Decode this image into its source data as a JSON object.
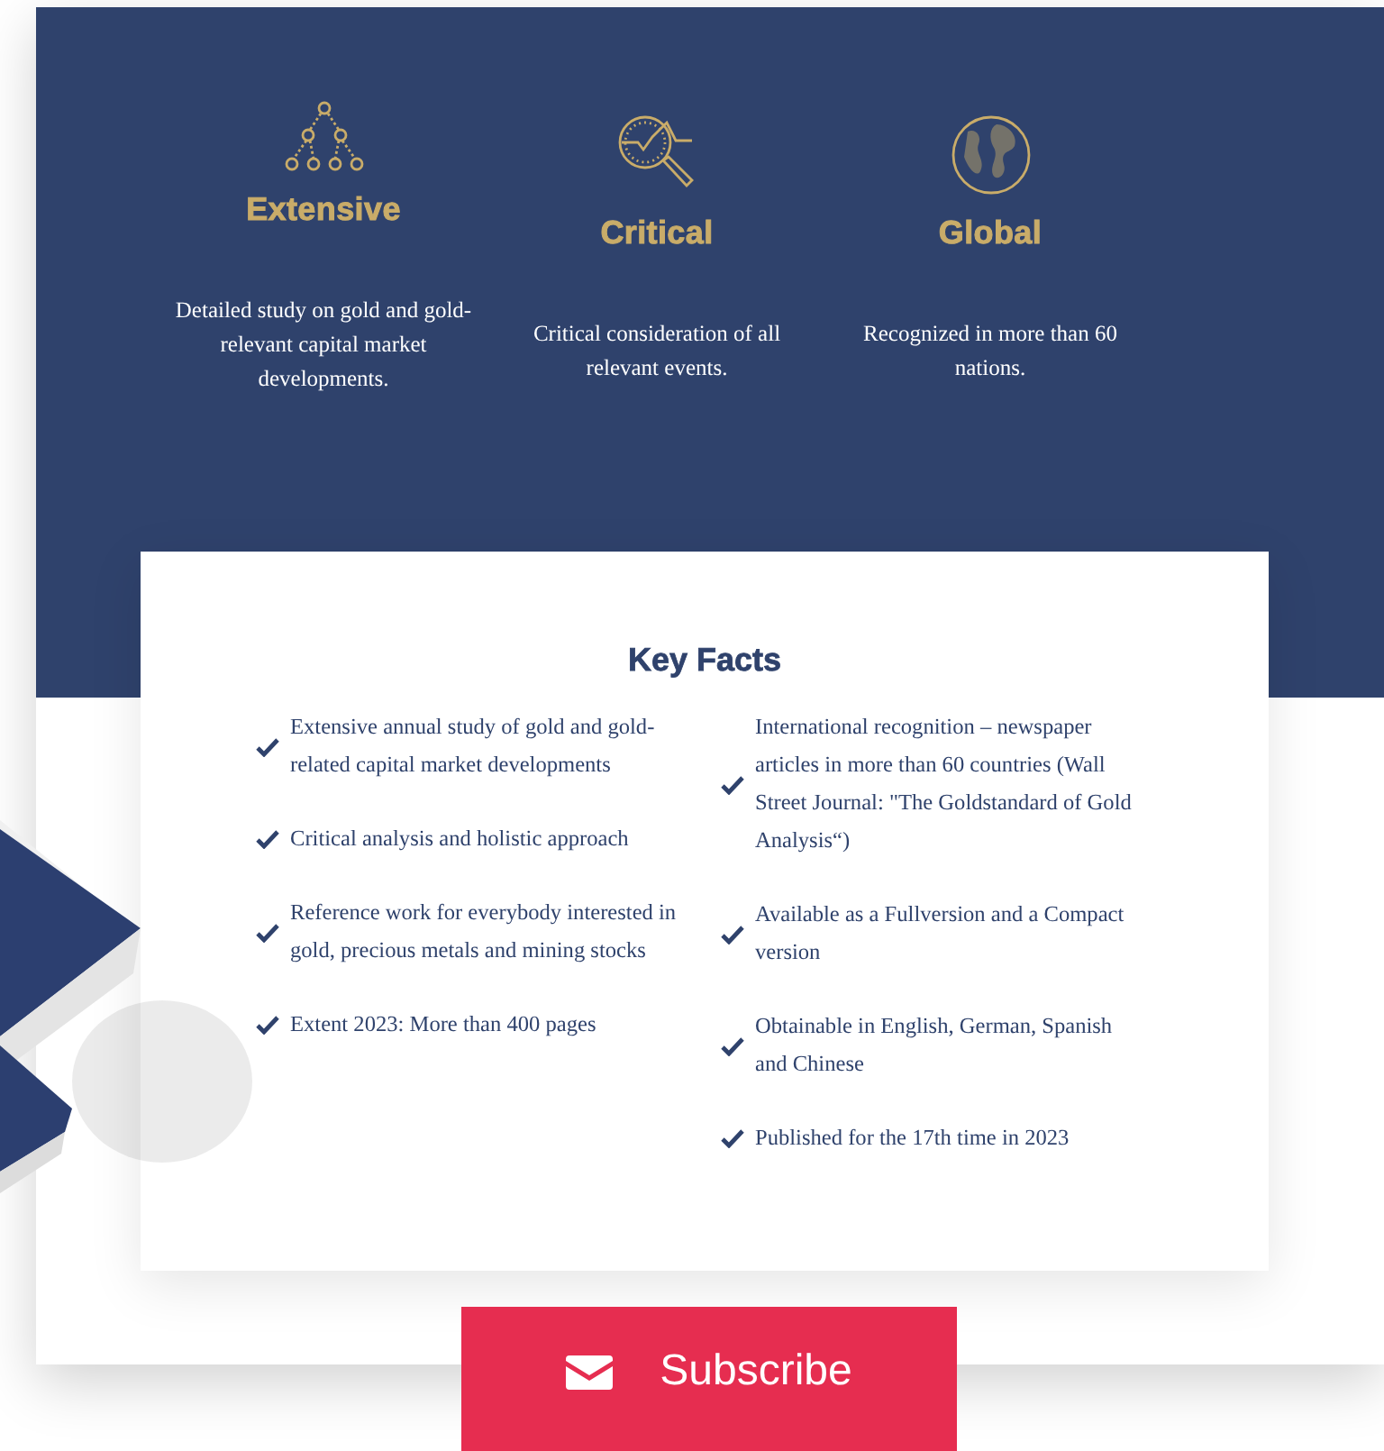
{
  "features": [
    {
      "kind": "hierarchy",
      "title": "Extensive",
      "text": "Detailed study on gold and gold-relevant capital market developments."
    },
    {
      "kind": "analysis",
      "title": "Critical",
      "text": "Critical consideration of all relevant events."
    },
    {
      "kind": "globe",
      "title": "Global",
      "text": "Recognized in more than 60 nations."
    }
  ],
  "key_facts": {
    "title": "Key Facts",
    "columns": [
      [
        "Extensive annual study of gold and gold-related capital market developments",
        "Critical analysis and holistic approach",
        "Reference work for everybody interested in gold, precious metals and mining stocks",
        "Extent 2023: More than 400 pages"
      ],
      [
        "International recognition – newspaper articles in more than 60 countries (Wall Street Journal: \"The Goldstandard of Gold Analysis“)",
        "Available as a Fullversion and a Compact version",
        "Obtainable in English, German, Spanish and Chinese",
        "Published for the 17th time in 2023"
      ]
    ]
  },
  "subscribe_button": {
    "label": "Subscribe"
  }
}
